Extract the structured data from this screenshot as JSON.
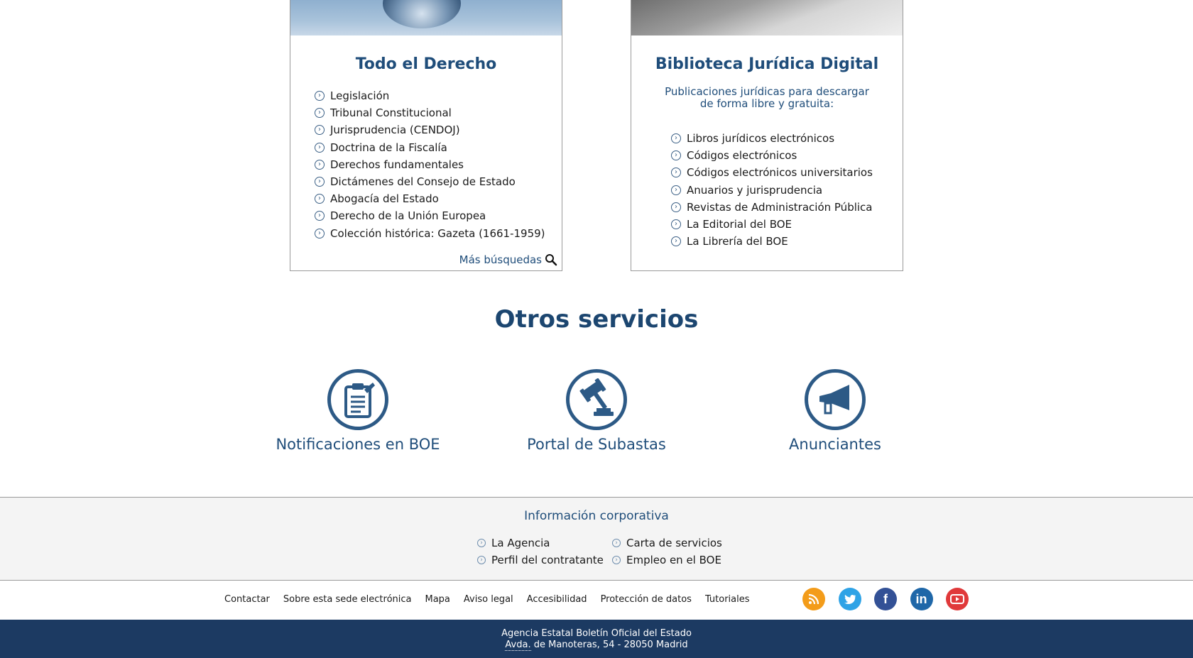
{
  "todo_derecho": {
    "title": "Todo el Derecho",
    "items": [
      "Legislación",
      "Tribunal Constitucional",
      "Jurisprudencia (CENDOJ)",
      "Doctrina de la Fiscalía",
      "Derechos fundamentales",
      "Dictámenes del Consejo de Estado",
      "Abogacía del Estado",
      "Derecho de la Unión Europea",
      "Colección histórica: Gazeta (1661-1959)"
    ],
    "more_label": "Más búsquedas"
  },
  "biblioteca": {
    "title": "Biblioteca Jurídica Digital",
    "subtitle": "Publicaciones jurídicas para descargar de forma libre y gratuita:",
    "items": [
      "Libros jurídicos electrónicos",
      "Códigos electrónicos",
      "Códigos electrónicos universitarios",
      "Anuarios y jurisprudencia",
      "Revistas de Administración Pública",
      "La Editorial del BOE",
      "La Librería del BOE"
    ]
  },
  "otros_servicios": {
    "title": "Otros servicios",
    "items": [
      {
        "label": "Notificaciones en BOE",
        "icon": "clipboard-icon"
      },
      {
        "label": "Portal de Subastas",
        "icon": "gavel-icon"
      },
      {
        "label": "Anunciantes",
        "icon": "megaphone-icon"
      }
    ]
  },
  "corporativa": {
    "title": "Información corporativa",
    "items": [
      "La Agencia",
      "Carta de servicios",
      "Perfil del contratante",
      "Empleo en el BOE"
    ]
  },
  "footer": {
    "links": [
      "Contactar",
      "Sobre esta sede electrónica",
      "Mapa",
      "Aviso legal",
      "Accesibilidad",
      "Protección de datos",
      "Tutoriales"
    ],
    "social": [
      "rss-icon",
      "twitter-icon",
      "facebook-icon",
      "linkedin-icon",
      "youtube-icon"
    ],
    "address_line1": "Agencia Estatal Boletín Oficial del Estado",
    "address_abbr": "Avda.",
    "address_rest": " de Manoteras, 54 - 28050 Madrid"
  },
  "colors": {
    "brand_blue": "#1f4d7a",
    "bottom_bar": "#1c3a62",
    "rss": "#f39c1a",
    "twitter": "#2fa3e6",
    "facebook": "#335196",
    "linkedin": "#1f67a8",
    "youtube": "#e0393a"
  }
}
